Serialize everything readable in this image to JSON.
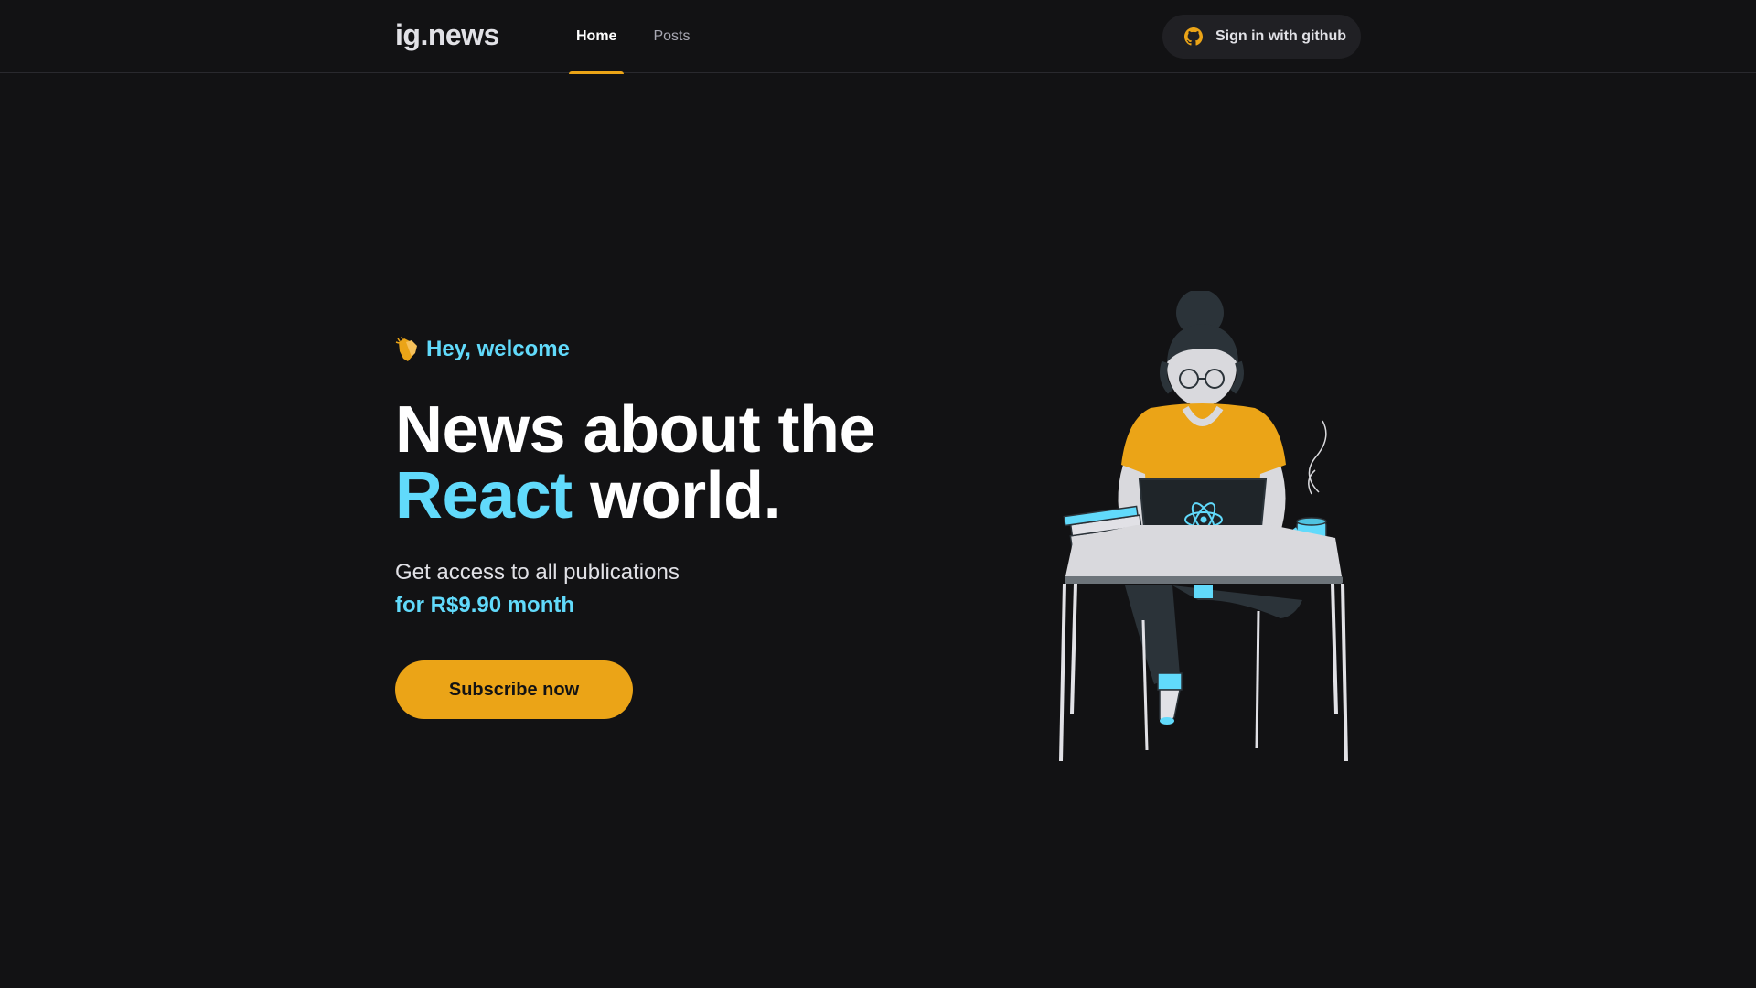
{
  "header": {
    "logo": "ig.news",
    "nav": [
      {
        "label": "Home",
        "active": true
      },
      {
        "label": "Posts",
        "active": false
      }
    ],
    "signin_label": "Sign in with github",
    "signin_icon": "github-icon"
  },
  "hero": {
    "welcome": "Hey, welcome",
    "welcome_icon": "clapping-hands-icon",
    "headline_line1": "News about the",
    "headline_accent": "React",
    "headline_rest": " world.",
    "subtitle": "Get access to all publications",
    "price": "for R$9.90 month",
    "cta_label": "Subscribe now"
  },
  "colors": {
    "background": "#121214",
    "accent_yellow": "#eba417",
    "accent_cyan": "#61dafb",
    "text": "#e1e1e6"
  }
}
